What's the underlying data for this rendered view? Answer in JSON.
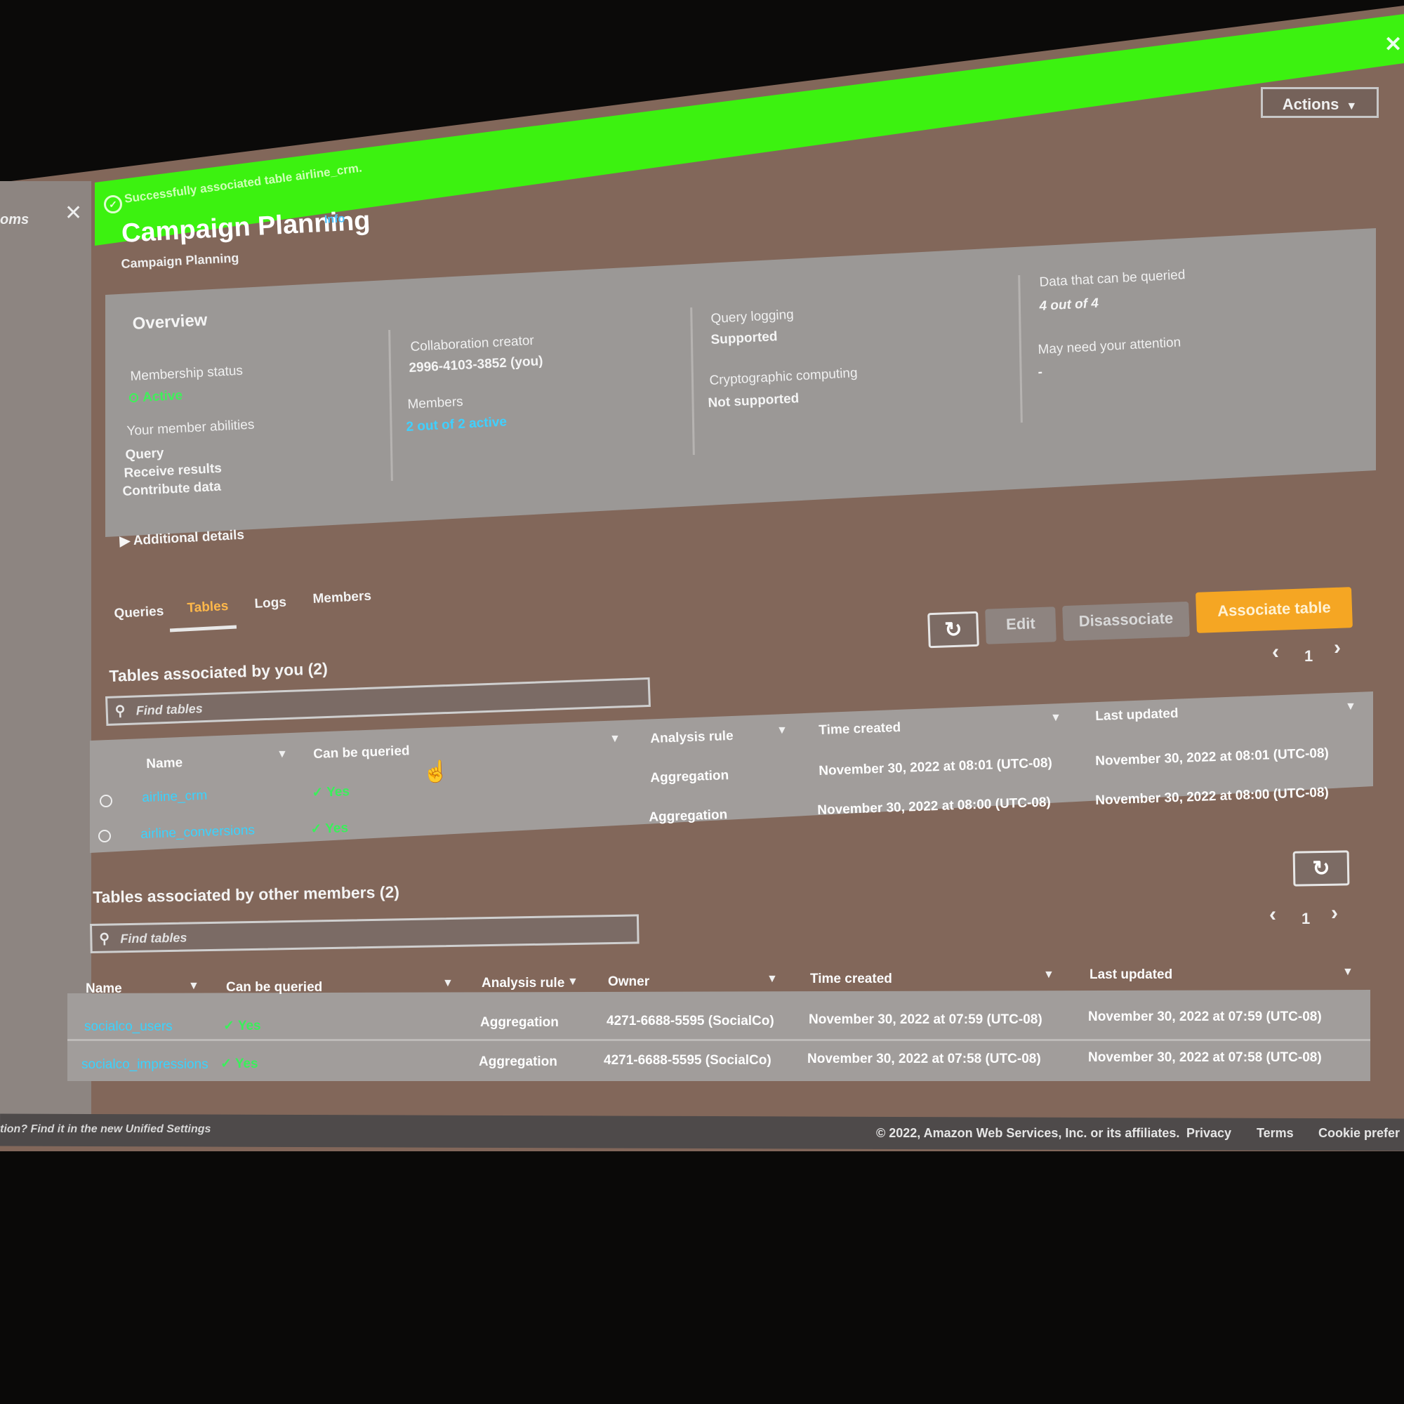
{
  "flash": {
    "message": "Successfully associated table airline_crm.",
    "close": "✕",
    "color": "#3cf210"
  },
  "side_panel": {
    "label": "oms",
    "close": "✕"
  },
  "header": {
    "actions_label": "Actions",
    "title": "Campaign Planning",
    "info": "Info",
    "subtitle": "Campaign Planning"
  },
  "overview": {
    "heading": "Overview",
    "membership_status_label": "Membership status",
    "membership_status_value": "Active",
    "abilities_label": "Your member abilities",
    "abilities": [
      "Query",
      "Receive results",
      "Contribute data"
    ],
    "creator_label": "Collaboration creator",
    "creator_value": "2996-4103-3852 (you)",
    "members_label": "Members",
    "members_value": "2 out of 2 active",
    "query_logging_label": "Query logging",
    "query_logging_value": "Supported",
    "crypto_label": "Cryptographic computing",
    "crypto_value": "Not supported",
    "queryable_label": "Data that can be queried",
    "queryable_value": "4 out of 4",
    "attention_label": "May need your attention",
    "attention_value": "-",
    "additional_details": "Additional details"
  },
  "tabs": [
    {
      "label": "Queries"
    },
    {
      "label": "Tables",
      "active": true
    },
    {
      "label": "Logs"
    },
    {
      "label": "Members"
    }
  ],
  "toolbar": {
    "refresh": "↻",
    "edit": "Edit",
    "disassociate": "Disassociate",
    "associate": "Associate table",
    "accent": "#f5a623"
  },
  "pager": {
    "prev": "‹",
    "page": "1",
    "next": "›"
  },
  "my_tables": {
    "title": "Tables associated by you (2)",
    "search_placeholder": "Find tables",
    "columns": [
      "Name",
      "Can be queried",
      "Analysis rule",
      "Time created",
      "Last updated"
    ],
    "rows": [
      {
        "name": "airline_crm",
        "queryable": "Yes",
        "rule": "Aggregation",
        "created": "November 30, 2022 at 08:01 (UTC-08)",
        "updated": "November 30, 2022 at 08:01 (UTC-08)"
      },
      {
        "name": "airline_conversions",
        "queryable": "Yes",
        "rule": "Aggregation",
        "created": "November 30, 2022 at 08:00 (UTC-08)",
        "updated": "November 30, 2022 at 08:00 (UTC-08)"
      }
    ]
  },
  "other_tables": {
    "title": "Tables associated by other members (2)",
    "search_placeholder": "Find tables",
    "columns": [
      "Name",
      "Can be queried",
      "Analysis rule",
      "Owner",
      "Time created",
      "Last updated"
    ],
    "rows": [
      {
        "name": "socialco_users",
        "queryable": "Yes",
        "rule": "Aggregation",
        "owner": "4271-6688-5595 (SocialCo)",
        "created": "November 30, 2022 at 07:59 (UTC-08)",
        "updated": "November 30, 2022 at 07:59 (UTC-08)"
      },
      {
        "name": "socialco_impressions",
        "queryable": "Yes",
        "rule": "Aggregation",
        "owner": "4271-6688-5595 (SocialCo)",
        "created": "November 30, 2022 at 07:58 (UTC-08)",
        "updated": "November 30, 2022 at 07:58 (UTC-08)"
      }
    ]
  },
  "footer": {
    "left": "tion? Find it in the new Unified Settings",
    "copyright": "© 2022, Amazon Web Services, Inc. or its affiliates.",
    "privacy": "Privacy",
    "terms": "Terms",
    "cookie": "Cookie prefer"
  }
}
